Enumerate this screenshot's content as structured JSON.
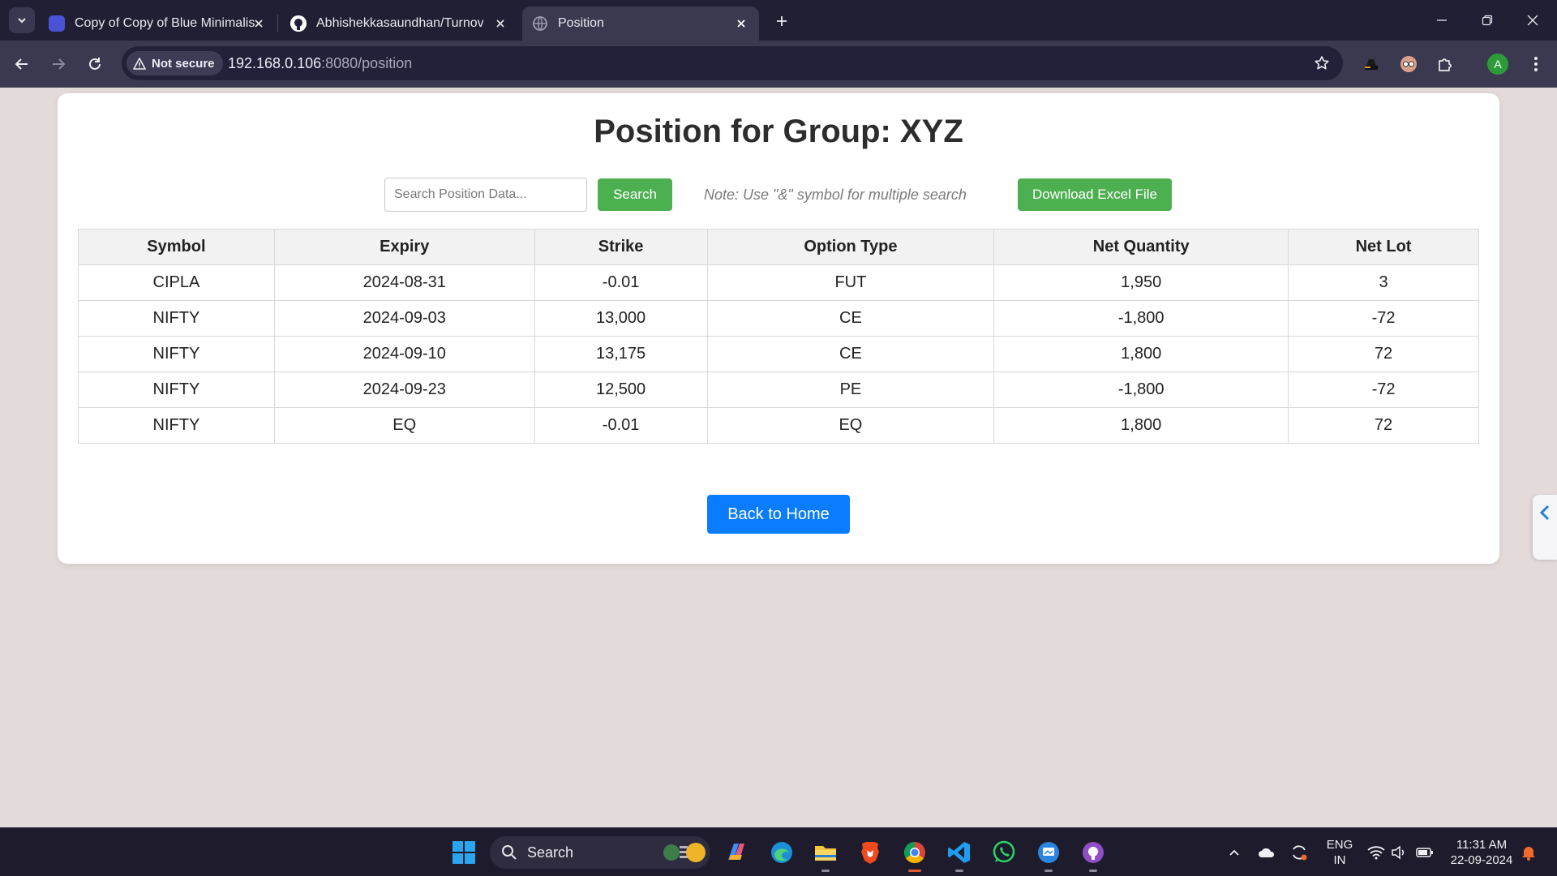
{
  "browser": {
    "tabs": [
      {
        "title": "Copy of Copy of Blue Minimalis",
        "favicon_color": "#4a52d6"
      },
      {
        "title": "Abhishekkasaundhan/Turnover",
        "favicon_color": "#ffffff"
      },
      {
        "title": "Position",
        "favicon_color": "#8d8b9e"
      }
    ],
    "security_label": "Not secure",
    "url_host": "192.168.0.106",
    "url_rest": ":8080/position",
    "profile_initial": "A"
  },
  "page": {
    "title": "Position for Group: XYZ",
    "search_placeholder": "Search Position Data...",
    "search_button": "Search",
    "note": "Note: Use \"&\" symbol for multiple search",
    "download_button": "Download Excel File",
    "back_button": "Back to Home",
    "table": {
      "headers": [
        "Symbol",
        "Expiry",
        "Strike",
        "Option Type",
        "Net Quantity",
        "Net Lot"
      ],
      "rows": [
        [
          "CIPLA",
          "2024-08-31",
          "-0.01",
          "FUT",
          "1,950",
          "3"
        ],
        [
          "NIFTY",
          "2024-09-03",
          "13,000",
          "CE",
          "-1,800",
          "-72"
        ],
        [
          "NIFTY",
          "2024-09-10",
          "13,175",
          "CE",
          "1,800",
          "72"
        ],
        [
          "NIFTY",
          "2024-09-23",
          "12,500",
          "PE",
          "-1,800",
          "-72"
        ],
        [
          "NIFTY",
          "EQ",
          "-0.01",
          "EQ",
          "1,800",
          "72"
        ]
      ]
    }
  },
  "taskbar": {
    "search_label": "Search",
    "language_line1": "ENG",
    "language_line2": "IN",
    "time": "11:31 AM",
    "date": "22-09-2024"
  },
  "colors": {
    "accent_green": "#4caf50",
    "accent_blue": "#0a7cff",
    "page_background": "#e3dada"
  }
}
